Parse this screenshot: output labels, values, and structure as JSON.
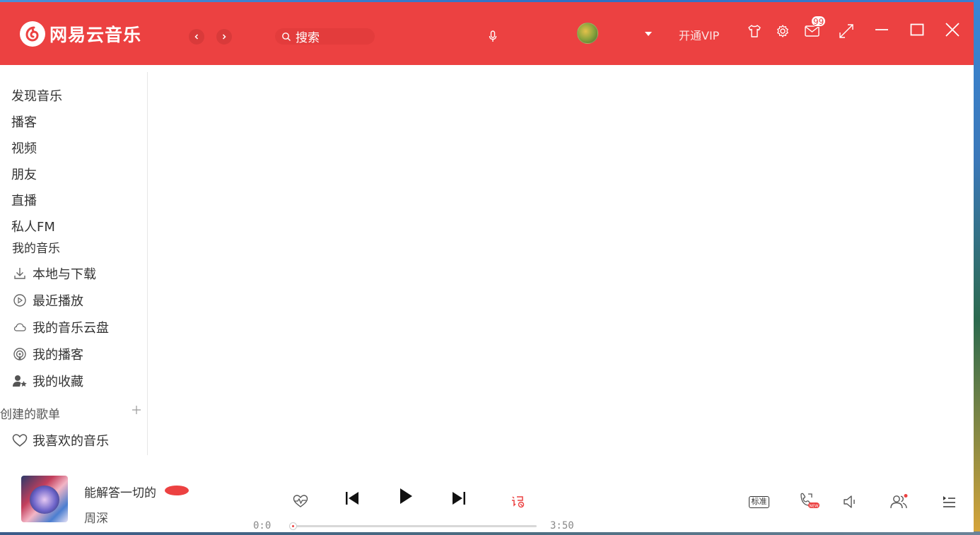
{
  "app": {
    "name": "网易云音乐",
    "accent_color": "#ec4141"
  },
  "header": {
    "logo_icon": "netease-cloud-music-logo-icon",
    "back_icon": "chevron-left-icon",
    "forward_icon": "chevron-right-icon",
    "search": {
      "icon": "search-icon",
      "placeholder": "搜索"
    },
    "mic_icon": "microphone-icon",
    "avatar_icon": "user-avatar",
    "dropdown_icon": "caret-down-icon",
    "vip_label": "开通VIP",
    "skin_icon": "tshirt-icon",
    "settings_icon": "gear-icon",
    "mail_icon": "mail-icon",
    "mail_badge": "99",
    "mini_mode_icon": "shrink-icon",
    "minimize_icon": "minimize-icon",
    "maximize_icon": "maximize-icon",
    "close_icon": "close-icon"
  },
  "sidebar": {
    "main_items": [
      "发现音乐",
      "播客",
      "视频",
      "朋友",
      "直播",
      "私人FM"
    ],
    "my_music_title": "我的音乐",
    "my_music_items": [
      {
        "label": "本地与下载",
        "icon": "download-icon"
      },
      {
        "label": "最近播放",
        "icon": "recent-play-icon"
      },
      {
        "label": "我的音乐云盘",
        "icon": "cloud-icon"
      },
      {
        "label": "我的播客",
        "icon": "podcast-icon"
      },
      {
        "label": "我的收藏",
        "icon": "user-star-icon"
      }
    ],
    "created_playlists_title": "创建的歌单",
    "add_playlist_icon": "plus-icon",
    "liked_music": {
      "label": "我喜欢的音乐",
      "icon": "heart-icon"
    }
  },
  "player": {
    "song_title": "能解答一切的",
    "artist": "周深",
    "current_time": "0:0",
    "total_time": "3:50",
    "progress": 0.0,
    "heartbeat_icon": "heartbeat-mode-icon",
    "prev_icon": "skip-previous-icon",
    "play_icon": "play-icon",
    "next_icon": "skip-next-icon",
    "lyrics_icon": "lyrics-icon",
    "quality_label": "标准",
    "sound_effect_icon": "sound-effect-new-icon",
    "volume_icon": "volume-icon",
    "listen_together_icon": "listen-together-icon",
    "playlist_icon": "playlist-icon"
  }
}
